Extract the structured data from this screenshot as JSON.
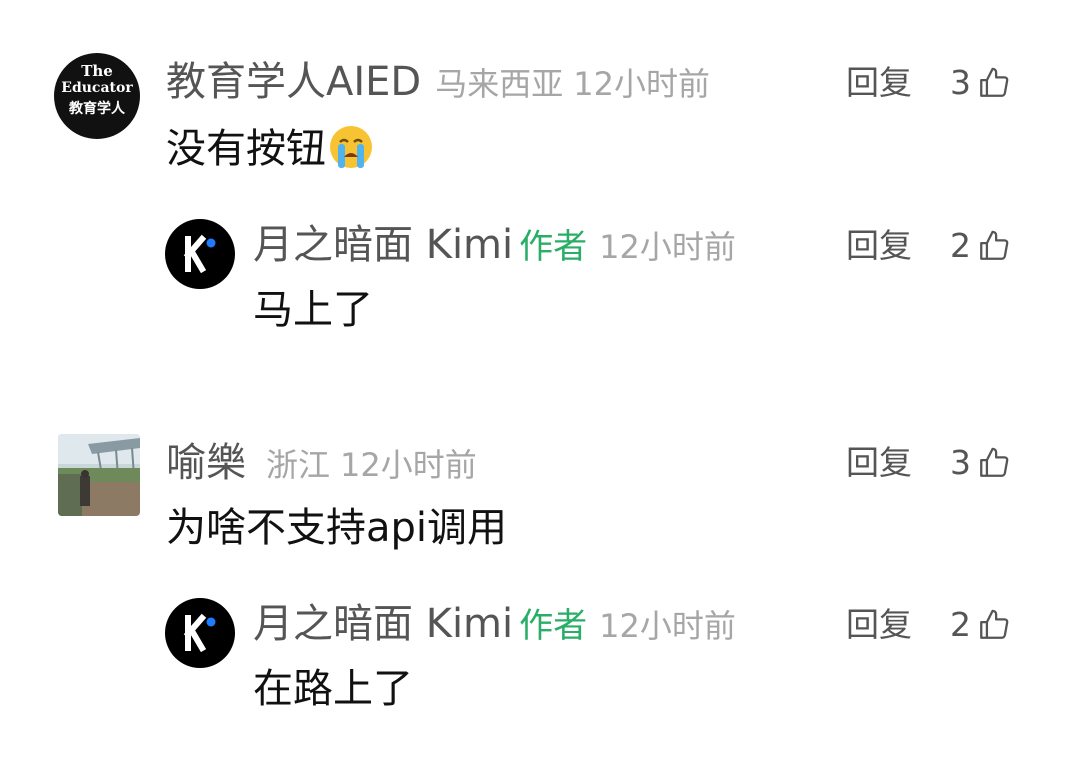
{
  "comments": [
    {
      "avatar": {
        "line1": "The",
        "line2": "Educator",
        "line3": "教育学人"
      },
      "author": "教育学人AIED",
      "location": "马来西亚",
      "time": "12小时前",
      "text": "没有按钮",
      "emoji": "crying-face",
      "reply_label": "回复",
      "likes": "3",
      "reply": {
        "author": "月之暗面 Kimi",
        "author_tag": "作者",
        "time": "12小时前",
        "text": "马上了",
        "reply_label": "回复",
        "likes": "2"
      }
    },
    {
      "author": "喻樂",
      "location": "浙江",
      "time": "12小时前",
      "text": "为啥不支持api调用",
      "reply_label": "回复",
      "likes": "3",
      "reply": {
        "author": "月之暗面 Kimi",
        "author_tag": "作者",
        "time": "12小时前",
        "text": "在路上了",
        "reply_label": "回复",
        "likes": "2"
      }
    }
  ],
  "icons": {
    "like": "thumbs-up-outline-icon",
    "kimi_logo": "kimi-k-logo-icon"
  },
  "colors": {
    "author_tag": "#2aae67",
    "name": "#555555",
    "meta": "#a6a6a6"
  }
}
